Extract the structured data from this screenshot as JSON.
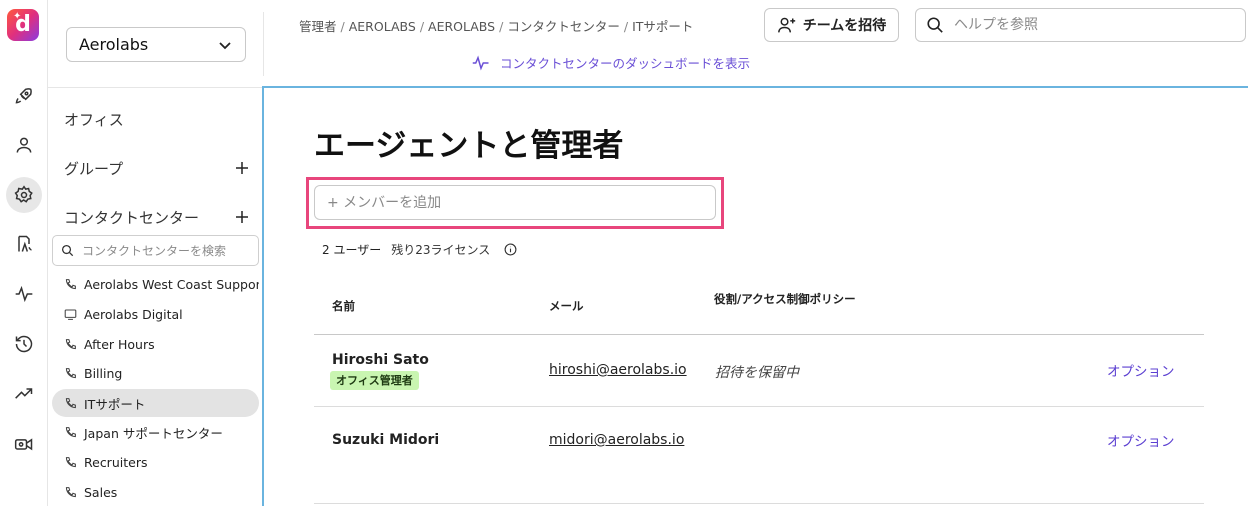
{
  "app": {
    "logo_letter": "d"
  },
  "header": {
    "org_select": "Aerolabs",
    "breadcrumb": [
      "管理者",
      "AEROLABS",
      "AEROLABS",
      "コンタクトセンター",
      "ITサポート"
    ],
    "dashboard_link": "コンタクトセンターのダッシュボードを表示",
    "invite_button": "チームを招待",
    "help_search_placeholder": "ヘルプを参照"
  },
  "rail": {
    "items": [
      "rocket-icon",
      "person-icon",
      "gear-icon",
      "phone-flow-icon",
      "activity-icon",
      "history-icon",
      "trend-icon",
      "video-icon"
    ],
    "active": "gear-icon"
  },
  "sidebar": {
    "sections": {
      "office": "オフィス",
      "group": "グループ",
      "contact_center": "コンタクトセンター"
    },
    "search_placeholder": "コンタクトセンターを検索",
    "items": [
      {
        "label": "Aerolabs West Coast Support",
        "icon": "phone-icon"
      },
      {
        "label": "Aerolabs Digital",
        "icon": "monitor-icon"
      },
      {
        "label": "After Hours",
        "icon": "phone-icon"
      },
      {
        "label": "Billing",
        "icon": "phone-icon"
      },
      {
        "label": "ITサポート",
        "icon": "phone-icon",
        "active": true
      },
      {
        "label": "Japan サポートセンター",
        "icon": "phone-icon"
      },
      {
        "label": "Recruiters",
        "icon": "phone-icon"
      },
      {
        "label": "Sales",
        "icon": "phone-icon"
      }
    ]
  },
  "main": {
    "title": "エージェントと管理者",
    "add_member_placeholder": "+ メンバーを追加",
    "user_count": "2 ユーザー",
    "licenses_remaining": "残り23ライセンス",
    "columns": {
      "name": "名前",
      "email": "メール",
      "role": "役割/アクセス制御ポリシー"
    },
    "rows": [
      {
        "name": "Hiroshi Sato",
        "badge": "オフィス管理者",
        "email": "hiroshi@aerolabs.io",
        "status": "招待を保留中",
        "option": "オプション"
      },
      {
        "name": "Suzuki Midori",
        "badge": "",
        "email": "midori@aerolabs.io",
        "status": "",
        "option": "オプション"
      }
    ]
  },
  "colors": {
    "accent": "#5b3fd1",
    "highlight": "#e8467c",
    "badge_bg": "#c9f5b1",
    "focus_border": "#6ab4df"
  }
}
